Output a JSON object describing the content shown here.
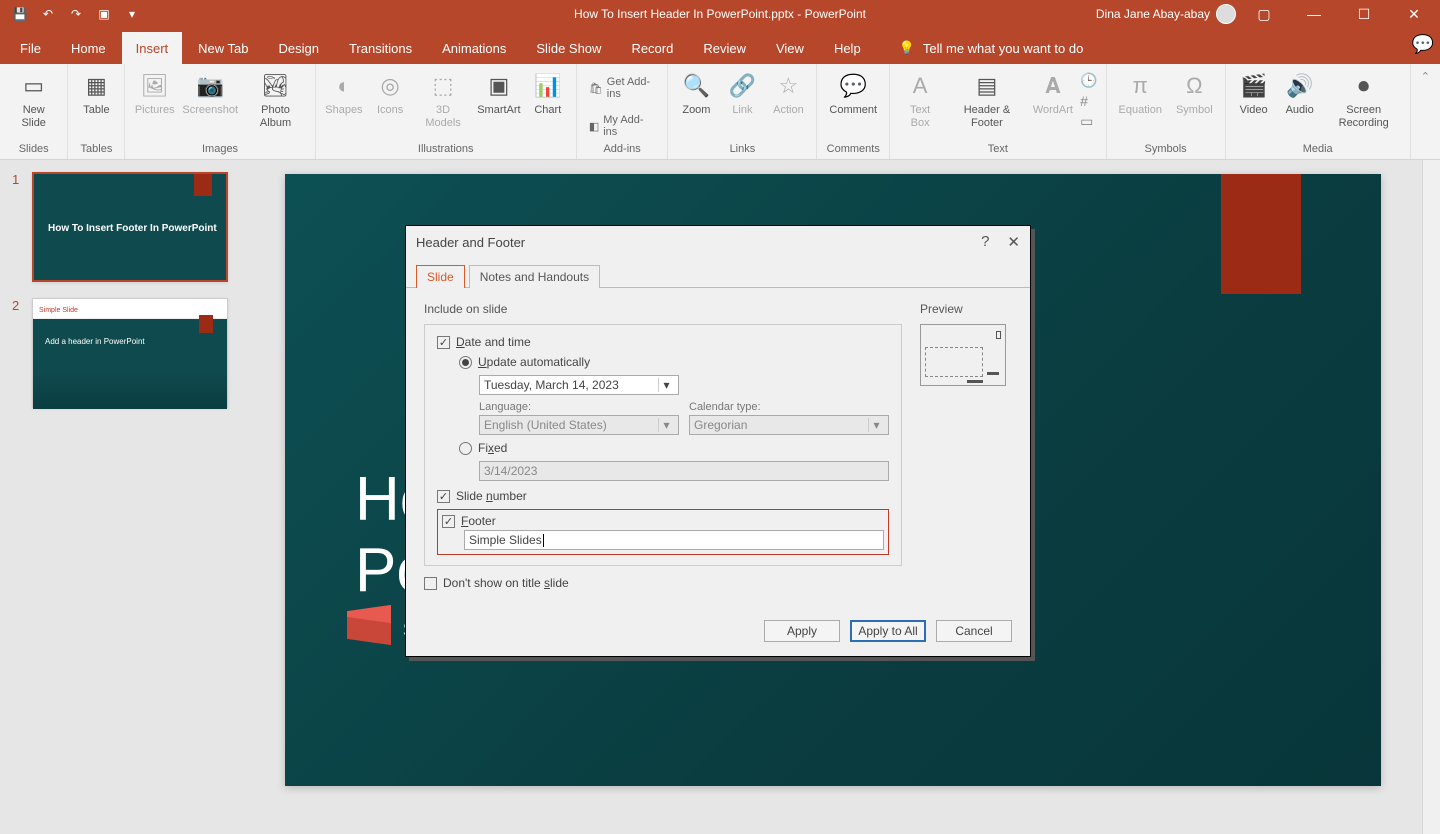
{
  "titlebar": {
    "document": "How To Insert Header In PowerPoint.pptx  -  PowerPoint",
    "user": "Dina Jane Abay-abay"
  },
  "tabs": {
    "file": "File",
    "home": "Home",
    "insert": "Insert",
    "newtab": "New Tab",
    "design": "Design",
    "transitions": "Transitions",
    "animations": "Animations",
    "slideshow": "Slide Show",
    "record": "Record",
    "review": "Review",
    "view": "View",
    "help": "Help",
    "tellme": "Tell me what you want to do"
  },
  "ribbon": {
    "slides": {
      "new_slide": "New\nSlide",
      "label": "Slides"
    },
    "tables": {
      "table": "Table",
      "label": "Tables"
    },
    "images": {
      "pictures": "Pictures",
      "screenshot": "Screenshot",
      "photo_album": "Photo\nAlbum",
      "label": "Images"
    },
    "illustrations": {
      "shapes": "Shapes",
      "icons": "Icons",
      "models": "3D\nModels",
      "smartart": "SmartArt",
      "chart": "Chart",
      "label": "Illustrations"
    },
    "addins": {
      "get": "Get Add-ins",
      "my": "My Add-ins",
      "label": "Add-ins"
    },
    "links": {
      "zoom": "Zoom",
      "link": "Link",
      "action": "Action",
      "label": "Links"
    },
    "comments": {
      "comment": "Comment",
      "label": "Comments"
    },
    "text": {
      "textbox": "Text\nBox",
      "header_footer": "Header\n& Footer",
      "wordart": "WordArt",
      "label": "Text"
    },
    "symbols": {
      "equation": "Equation",
      "symbol": "Symbol",
      "label": "Symbols"
    },
    "media": {
      "video": "Video",
      "audio": "Audio",
      "screen": "Screen\nRecording",
      "label": "Media"
    }
  },
  "thumbs": {
    "n1": "1",
    "t1": "How To Insert Footer In\nPowerPoint",
    "n2": "2",
    "t2_top": "Simple Slide",
    "t2": "Add a header in PowerPoint"
  },
  "slide": {
    "title_line1": "How To Insert Footer In",
    "title_line2": "PowerPoint",
    "logo": "simple slides"
  },
  "dialog": {
    "title": "Header and Footer",
    "tab_slide": "Slide",
    "tab_notes": "Notes and Handouts",
    "include_label": "Include on slide",
    "date_time": "Date and time",
    "update_auto": "Update automatically",
    "date_value": "Tuesday, March 14, 2023",
    "language_label": "Language:",
    "language_value": "English (United States)",
    "calendar_label": "Calendar type:",
    "calendar_value": "Gregorian",
    "fixed": "Fixed",
    "fixed_value": "3/14/2023",
    "slide_number": "Slide number",
    "footer": "Footer",
    "footer_value": "Simple Slides",
    "dont_show": "Don't show on title slide",
    "preview_label": "Preview",
    "apply": "Apply",
    "apply_all": "Apply to All",
    "cancel": "Cancel"
  }
}
